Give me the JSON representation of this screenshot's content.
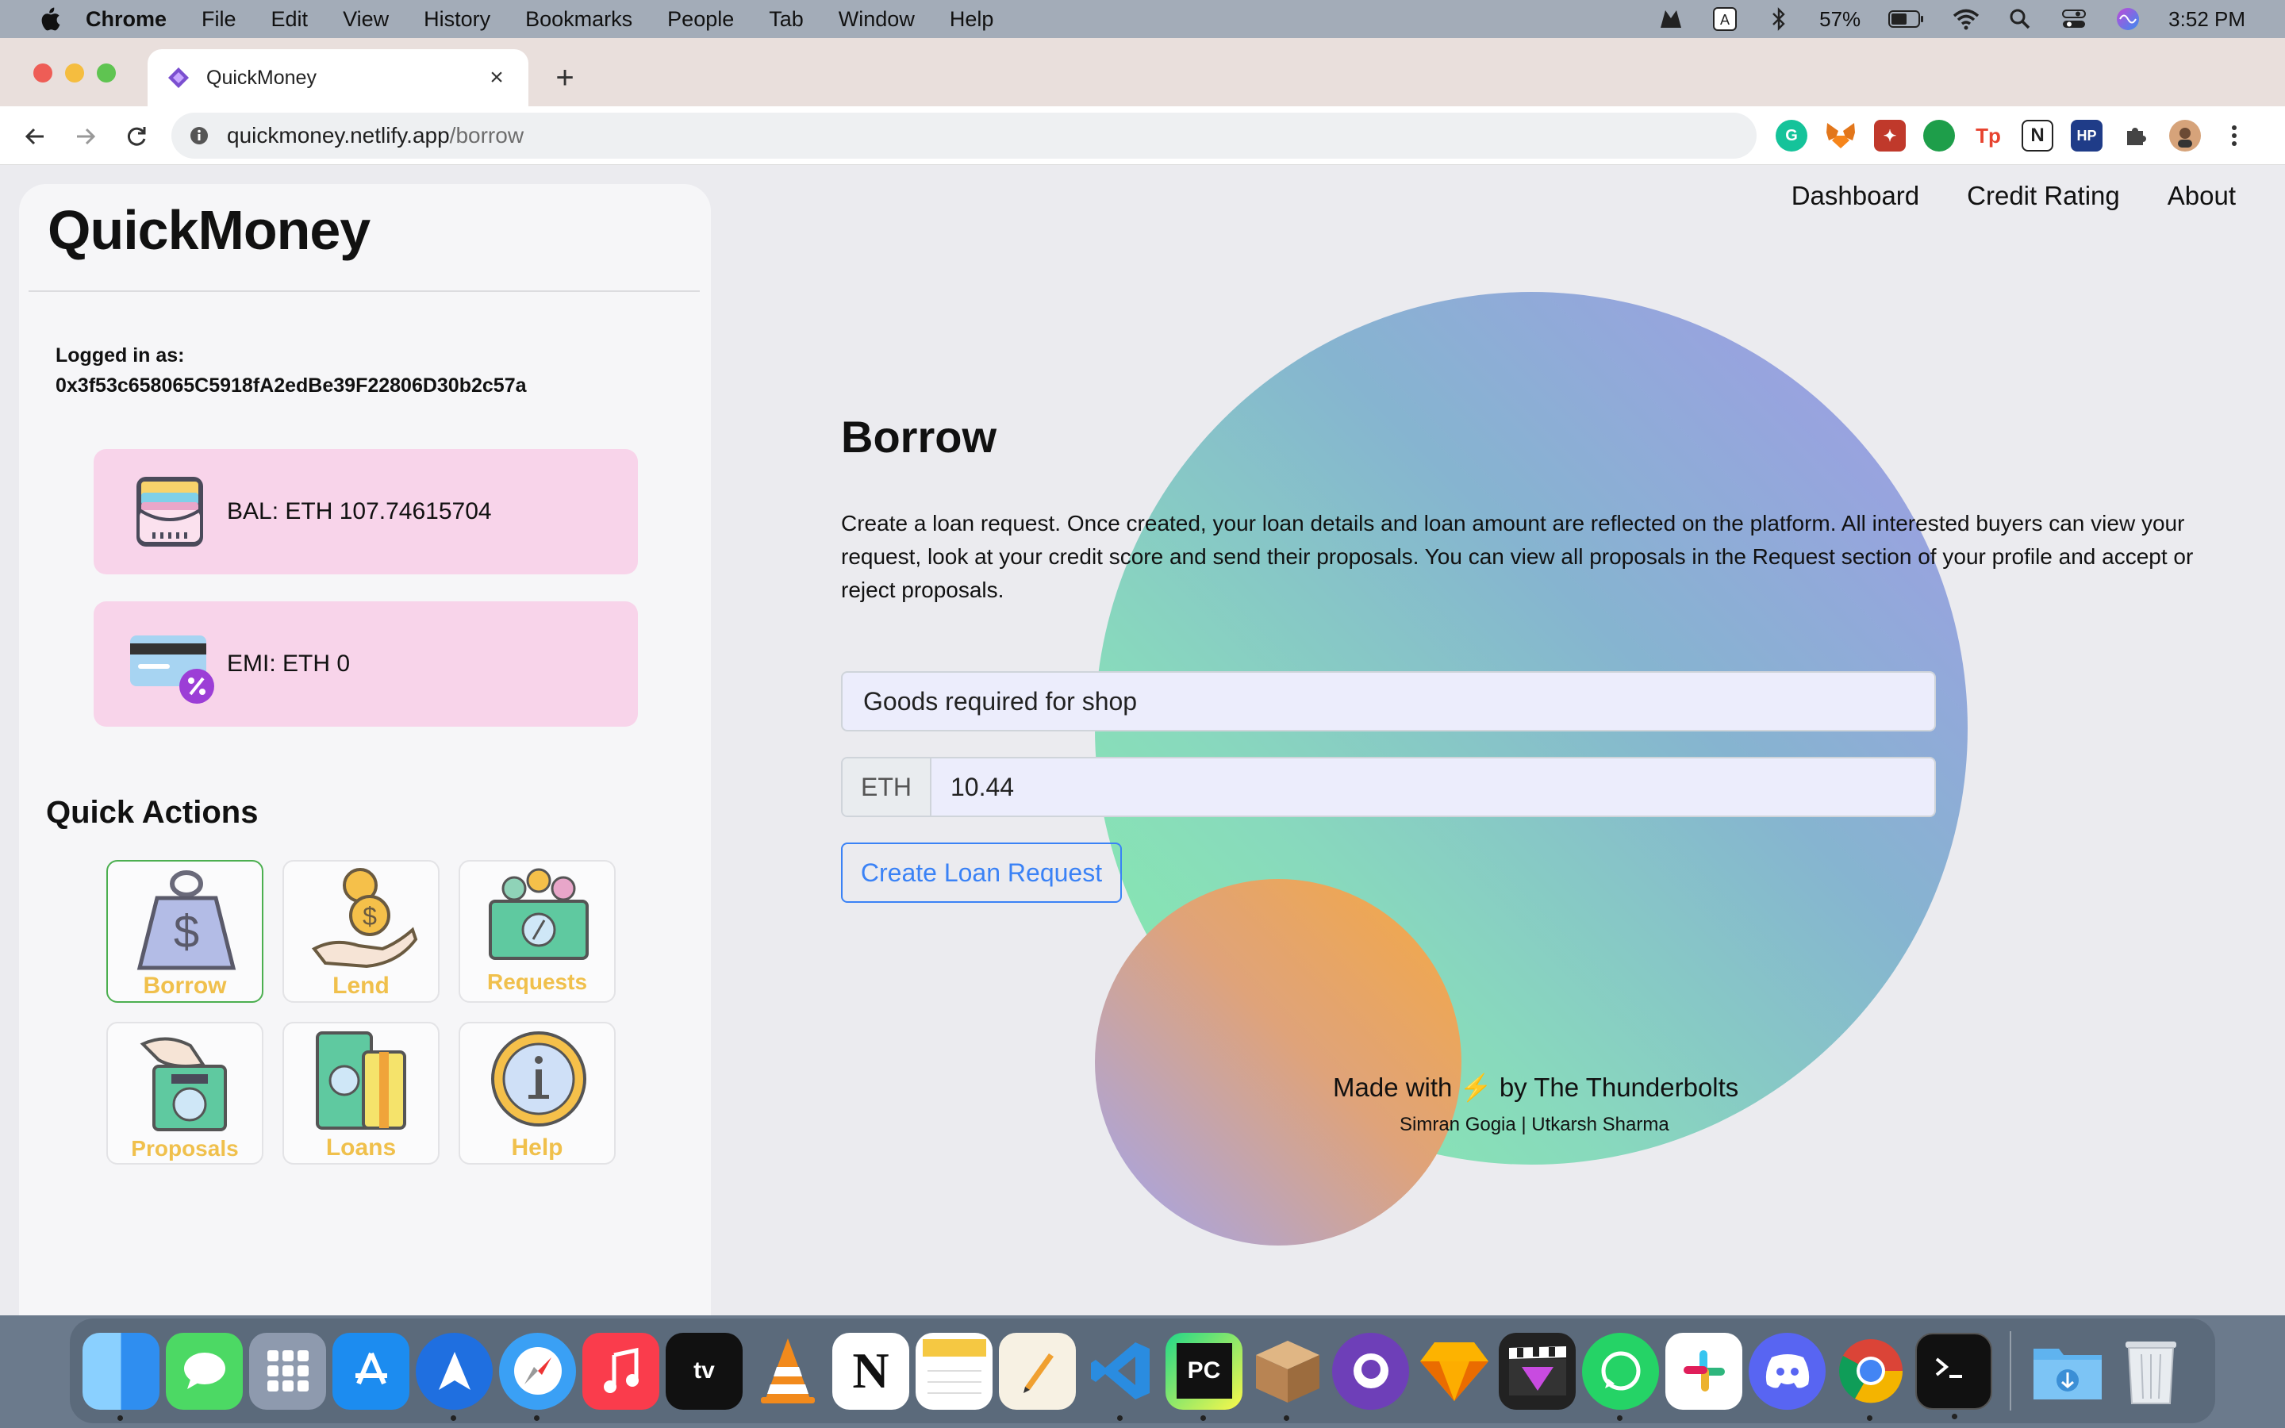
{
  "menubar": {
    "app": "Chrome",
    "items": [
      "File",
      "Edit",
      "View",
      "History",
      "Bookmarks",
      "People",
      "Tab",
      "Window",
      "Help"
    ],
    "battery": "57%",
    "input_source": "A",
    "time": "3:52 PM"
  },
  "browser": {
    "tab_title": "QuickMoney",
    "url_host": "quickmoney.netlify.app",
    "url_path": "/borrow",
    "extensions": [
      "grammarly-icon",
      "metamask-icon",
      "extension-icon",
      "chat-icon",
      "Tp",
      "N",
      "HP",
      "puzzle-icon",
      "profile-avatar"
    ]
  },
  "sidebar": {
    "brand": "QuickMoney",
    "logged_in_label": "Logged in as:",
    "address": "0x3f53c658065C5918fA2edBe39F22806D30b2c57a",
    "balance": "BAL: ETH 107.74615704",
    "emi": "EMI: ETH 0",
    "quick_actions_title": "Quick Actions",
    "actions": [
      "Borrow",
      "Lend",
      "Requests",
      "Proposals",
      "Loans",
      "Help"
    ]
  },
  "nav": {
    "links": [
      "Dashboard",
      "Credit Rating",
      "About"
    ]
  },
  "main": {
    "title": "Borrow",
    "description": "Create a loan request. Once created, your loan details and loan amount are reflected on the platform. All interested buyers can view your request, look at your credit score and send their proposals. You can view all proposals in the Request section of your profile and accept or reject proposals.",
    "purpose_value": "Goods required for shop",
    "currency": "ETH",
    "amount_value": "10.44",
    "submit_label": "Create Loan Request"
  },
  "footer": {
    "line1": "Made with ⚡ by The Thunderbolts",
    "line2": "Simran Gogia | Utkarsh Sharma"
  },
  "colors": {
    "accent": "#3a82f6",
    "card_pink": "#f8d4ea",
    "action_label": "#f0c04c",
    "active_border": "#4caf50"
  }
}
